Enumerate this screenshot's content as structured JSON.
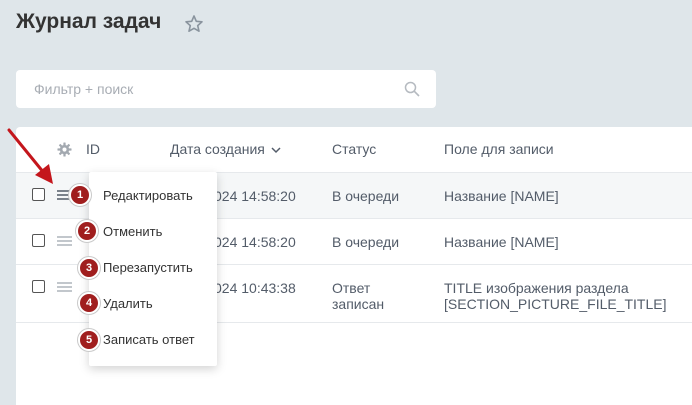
{
  "page": {
    "title": "Журнал задач"
  },
  "filter": {
    "placeholder": "Фильтр + поиск"
  },
  "grid": {
    "headers": {
      "id": "ID",
      "created": "Дата создания",
      "status": "Статус",
      "field": "Поле для записи"
    },
    "rows": [
      {
        "date": "024 14:58:20",
        "status": "В очереди",
        "field": "Название [NAME]"
      },
      {
        "date": "024 14:58:20",
        "status": "В очереди",
        "field": "Название [NAME]"
      },
      {
        "date": "024 10:43:38",
        "status_line1": "Ответ",
        "status_line2": "записан",
        "field_line1": "TITLE изображения раздела",
        "field_line2": "[SECTION_PICTURE_FILE_TITLE]"
      }
    ]
  },
  "context_menu": {
    "items": [
      {
        "label": "Редактировать",
        "badge": "1"
      },
      {
        "label": "Отменить",
        "badge": "2"
      },
      {
        "label": "Перезапустить",
        "badge": "3"
      },
      {
        "label": "Удалить",
        "badge": "4"
      },
      {
        "label": "Записать ответ",
        "badge": "5"
      }
    ]
  },
  "colors": {
    "badge": "#a01e1e",
    "arrow": "#c4161c",
    "background": "#dfe6ea"
  },
  "icons": [
    "star-icon",
    "search-icon",
    "gear-icon",
    "sort-chevron-icon",
    "menu-icon",
    "arrow-annotation"
  ]
}
